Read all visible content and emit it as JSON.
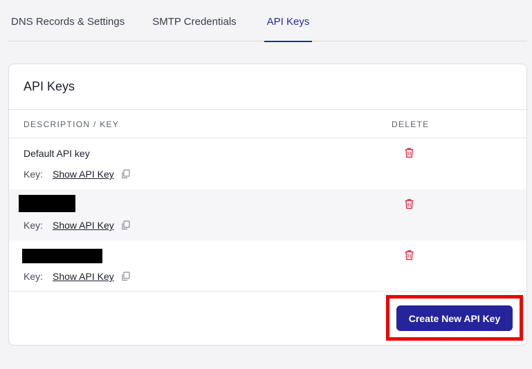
{
  "tabs": [
    {
      "label": "DNS Records & Settings"
    },
    {
      "label": "SMTP Credentials"
    },
    {
      "label": "API Keys"
    }
  ],
  "card": {
    "title": "API Keys",
    "columns": {
      "description": "DESCRIPTION / KEY",
      "delete": "DELETE"
    },
    "rows": [
      {
        "name": "Default API key",
        "key_label": "Key:",
        "key_link": "Show API Key"
      },
      {
        "name": "",
        "key_label": "Key:",
        "key_link": "Show API Key"
      },
      {
        "name": "",
        "key_label": "Key:",
        "key_link": "Show API Key"
      }
    ],
    "create_button": "Create New API Key"
  },
  "colors": {
    "accent": "#25249a",
    "delete": "#d9314a",
    "highlight": "#ee0000"
  },
  "icons": {
    "copy": "copy-icon",
    "delete": "trash-icon"
  }
}
